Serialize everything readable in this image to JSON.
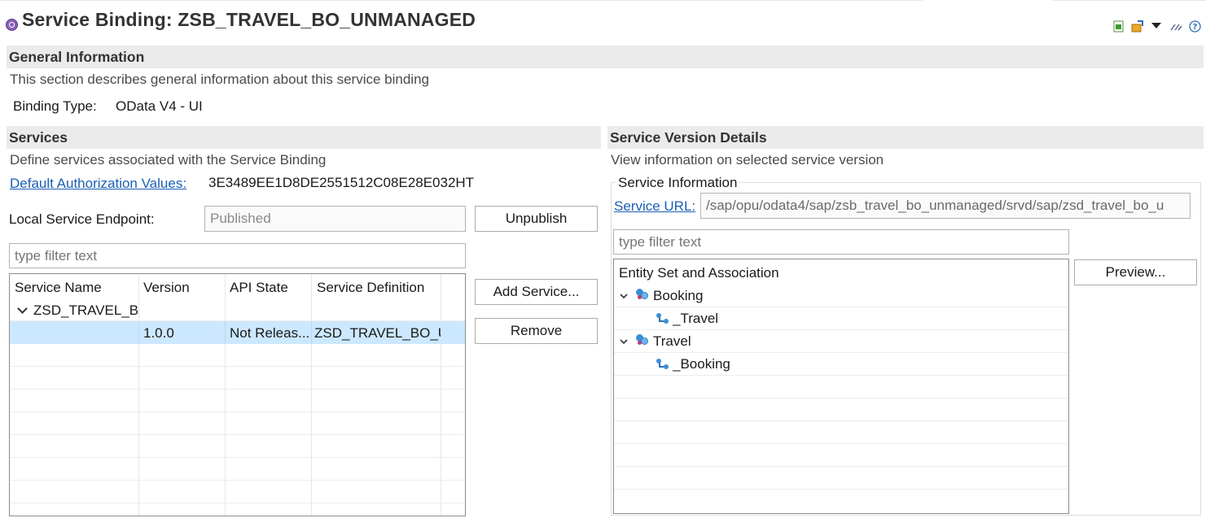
{
  "page": {
    "title": "Service Binding: ZSB_TRAVEL_BO_UNMANAGED"
  },
  "toolbar": {
    "icons": [
      "export-icon",
      "publish-icon",
      "dropdown-icon",
      "link-icon",
      "help-icon"
    ]
  },
  "general": {
    "heading": "General Information",
    "description": "This section describes general information about this service binding",
    "binding_type_label": "Binding Type:",
    "binding_type_value": "OData V4 - UI"
  },
  "services": {
    "heading": "Services",
    "description": "Define services associated with the Service Binding",
    "auth_link": "Default Authorization Values:",
    "auth_value": "3E3489EE1D8DE2551512C08E28E032HT",
    "endpoint_label": "Local Service Endpoint:",
    "endpoint_value": "Published",
    "unpublish_label": "Unpublish",
    "filter_placeholder": "type filter text",
    "add_service_label": "Add Service...",
    "remove_label": "Remove",
    "columns": [
      "Service Name",
      "Version",
      "API State",
      "Service Definition"
    ],
    "rows": [
      {
        "name": "ZSD_TRAVEL_BO",
        "version": "",
        "state": "",
        "definition": ""
      },
      {
        "name": "",
        "version": "1.0.0",
        "state": "Not Releas...",
        "definition": "ZSD_TRAVEL_BO_UI"
      }
    ]
  },
  "details": {
    "heading": "Service Version Details",
    "description": "View information on selected service version",
    "group_title": "Service Information",
    "url_link": "Service URL:",
    "url_value": "/sap/opu/odata4/sap/zsb_travel_bo_unmanaged/srvd/sap/zsd_travel_bo_u",
    "filter_placeholder": "type filter text",
    "tree_header": "Entity Set and Association",
    "preview_label": "Preview...",
    "tree": [
      {
        "label": "Booking",
        "child": "_Travel"
      },
      {
        "label": "Travel",
        "child": "_Booking"
      }
    ]
  },
  "colors": {
    "selection": "#cce8ff",
    "link": "#1a5fb4",
    "section_header": "#ebebeb"
  }
}
